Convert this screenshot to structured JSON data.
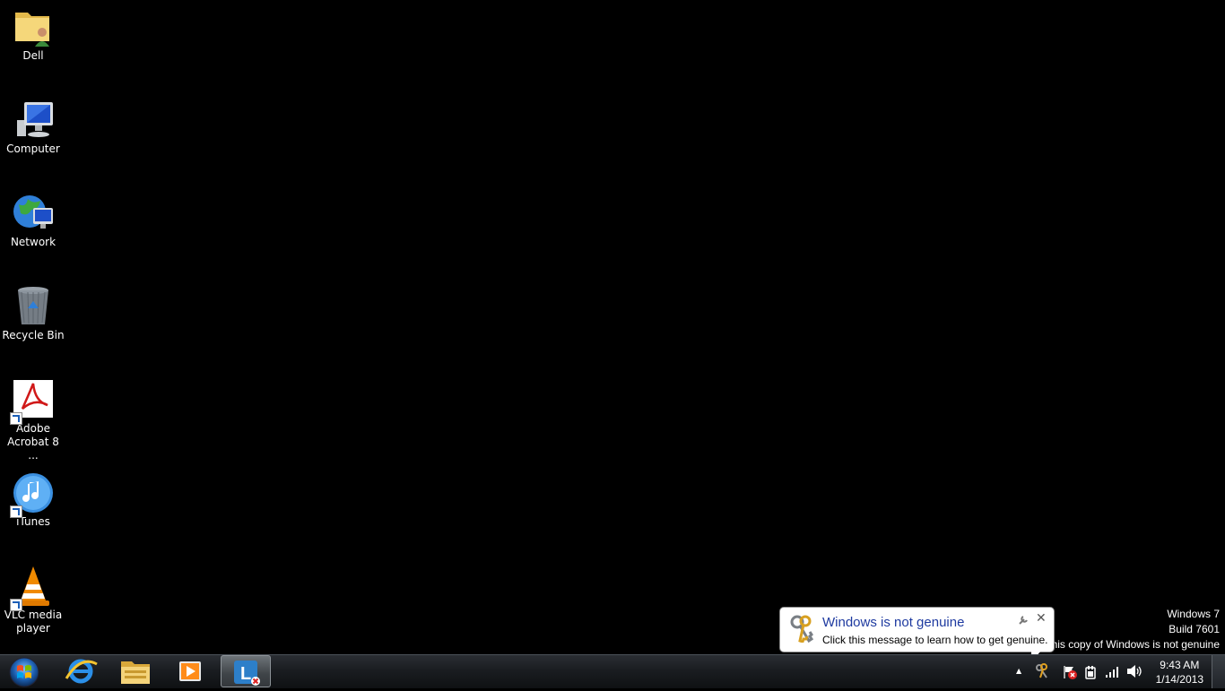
{
  "desktop": {
    "icons": [
      {
        "label": "Dell",
        "icon": "user-folder-icon"
      },
      {
        "label": "Computer",
        "icon": "computer-icon"
      },
      {
        "label": "Network",
        "icon": "network-icon"
      },
      {
        "label": "Recycle Bin",
        "icon": "recycle-bin-icon"
      },
      {
        "label": "Adobe\nAcrobat 8 ...",
        "icon": "adobe-acrobat-icon"
      },
      {
        "label": "iTunes",
        "icon": "itunes-icon"
      },
      {
        "label": "VLC media\nplayer",
        "icon": "vlc-icon"
      }
    ]
  },
  "watermark": {
    "line1": "Windows 7",
    "line2": "Build 7601",
    "line3": "This copy of Windows is not genuine"
  },
  "balloon": {
    "title": "Windows is not genuine",
    "message": "Click this message to learn how to get genuine.",
    "close": "✕"
  },
  "taskbar": {
    "pinned": [
      {
        "name": "internet-explorer",
        "icon": "ie-icon"
      },
      {
        "name": "windows-explorer",
        "icon": "folder-icon"
      },
      {
        "name": "media-player",
        "icon": "media-player-icon"
      },
      {
        "name": "lync",
        "icon": "lync-icon",
        "active": true
      }
    ],
    "tray": {
      "up_arrow": "▲",
      "icons": [
        "genuine-keys-icon",
        "action-center-flag-icon",
        "power-icon",
        "network-signal-icon",
        "volume-icon"
      ]
    },
    "clock": {
      "time": "9:43 AM",
      "date": "1/14/2013"
    }
  },
  "colors": {
    "desktop_bg": "#000000",
    "balloon_title": "#1e3aa0"
  }
}
